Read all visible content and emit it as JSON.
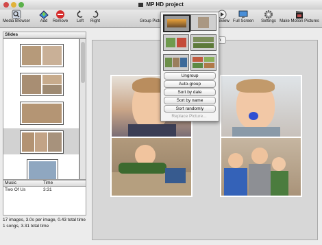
{
  "window": {
    "title": "MP HD project"
  },
  "toolbar": {
    "media_browser": "Media Browser",
    "add": "Add",
    "remove": "Remove",
    "left": "Left",
    "right": "Right",
    "group_picture": "Group Picture",
    "preview": "Preview",
    "full_screen": "Full Screen",
    "settings": "Settings",
    "make_motion_pictures": "Make Motion Pictures"
  },
  "sidebar": {
    "slides_header": "Slides",
    "music_header": "Music",
    "time_header": "Time",
    "music_rows": [
      {
        "title": "Two Of Us",
        "time": "3:31"
      }
    ]
  },
  "status": {
    "line1": "17 images, 3.0s per image, 0.43 total time",
    "line2": "1 songs, 3.31 total time"
  },
  "canvas": {
    "tab_label": "ion"
  },
  "popup": {
    "buttons": [
      "Ungroup",
      "Auto-group",
      "Sort by date",
      "Sort by name",
      "Sort randomly"
    ],
    "disabled_button": "Replace Picture..."
  },
  "colors": {
    "window_bg": "#ececec",
    "selection": "#d2d2d2",
    "canvas_bg": "#d7d7d7"
  }
}
